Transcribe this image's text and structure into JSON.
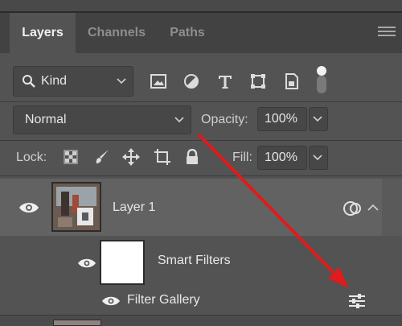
{
  "tabs": [
    {
      "label": "Layers",
      "active": true
    },
    {
      "label": "Channels",
      "active": false
    },
    {
      "label": "Paths",
      "active": false
    }
  ],
  "filter": {
    "kind_label": "Kind",
    "icons": [
      "image-filter-icon",
      "adjustment-filter-icon",
      "type-filter-icon",
      "shape-filter-icon",
      "smart-object-filter-icon",
      "filter-toggle-icon"
    ]
  },
  "blend": {
    "mode": "Normal"
  },
  "opacity": {
    "label": "Opacity:",
    "value": "100%"
  },
  "lock": {
    "label": "Lock:",
    "icons": [
      "lock-transparent-pixels-icon",
      "lock-image-pixels-icon",
      "lock-position-icon",
      "lock-artboard-icon",
      "lock-all-icon"
    ]
  },
  "fill": {
    "label": "Fill:",
    "value": "100%"
  },
  "layers": {
    "layer1_name": "Layer 1",
    "smart_filters_label": "Smart Filters",
    "filter_gallery_label": "Filter Gallery"
  },
  "colors": {
    "panel_bg": "#535353",
    "tab_bar_bg": "#424242",
    "selected_layer_bg": "#626262",
    "annotation_arrow": "#e01b1b"
  }
}
